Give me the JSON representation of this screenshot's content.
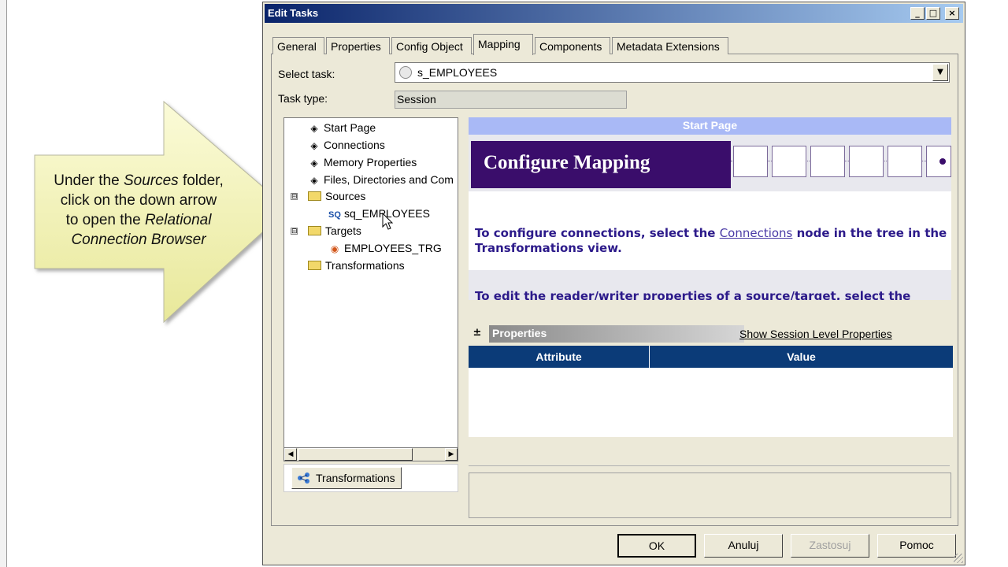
{
  "dialog": {
    "title": "Edit Tasks",
    "buttons": {
      "minimize": "_",
      "maximize": "□",
      "close": "×"
    }
  },
  "tabs": [
    "General",
    "Properties",
    "Config Object",
    "Mapping",
    "Components",
    "Metadata Extensions"
  ],
  "active_tab": "Mapping",
  "select_task": {
    "label": "Select task:",
    "value": "s_EMPLOYEES"
  },
  "task_type": {
    "label": "Task type:",
    "value": "Session"
  },
  "tree": {
    "items": [
      {
        "label": "Start Page",
        "icon": "diamond-icon"
      },
      {
        "label": "Connections",
        "icon": "diamond-icon"
      },
      {
        "label": "Memory Properties",
        "icon": "diamond-icon"
      },
      {
        "label": "Files, Directories and Com",
        "icon": "diamond-icon"
      },
      {
        "label": "Sources",
        "icon": "folder-icon"
      },
      {
        "label": "sq_EMPLOYEES",
        "icon": "source-qualifier-icon",
        "badge": "SQ"
      },
      {
        "label": "Targets",
        "icon": "folder-icon"
      },
      {
        "label": "EMPLOYEES_TRG",
        "icon": "target-icon"
      },
      {
        "label": "Transformations",
        "icon": "folder-icon"
      }
    ],
    "expander_collapse": "⊟",
    "transformations_button": "Transformations"
  },
  "start_page": {
    "header": "Start Page",
    "banner": "Configure Mapping",
    "text1_pre": "To configure connections, select the ",
    "text1_link": "Connections",
    "text1_post": " node in the tree in the Transformations view.",
    "text2": "To edit the reader/writer properties of a source/target, select the"
  },
  "properties": {
    "toggle": "±",
    "title": "Properties",
    "link": "Show Session Level Properties",
    "columns": [
      "Attribute",
      "Value"
    ]
  },
  "footer_buttons": {
    "ok": "OK",
    "cancel": "Anuluj",
    "apply": "Zastosuj",
    "help": "Pomoc"
  },
  "callout": {
    "line1": "Under the ",
    "line1_em": "Sources",
    "line1_post": " folder,",
    "line2": "click on the down arrow",
    "line3": "to open the ",
    "line3_em": "Relational",
    "line4_em": "Connection Browser"
  },
  "colors": {
    "callout_fill": "#f3f3b8",
    "titlebar": "#0a246a",
    "banner": "#3a0d6b",
    "grid_header": "#0b3b78"
  }
}
